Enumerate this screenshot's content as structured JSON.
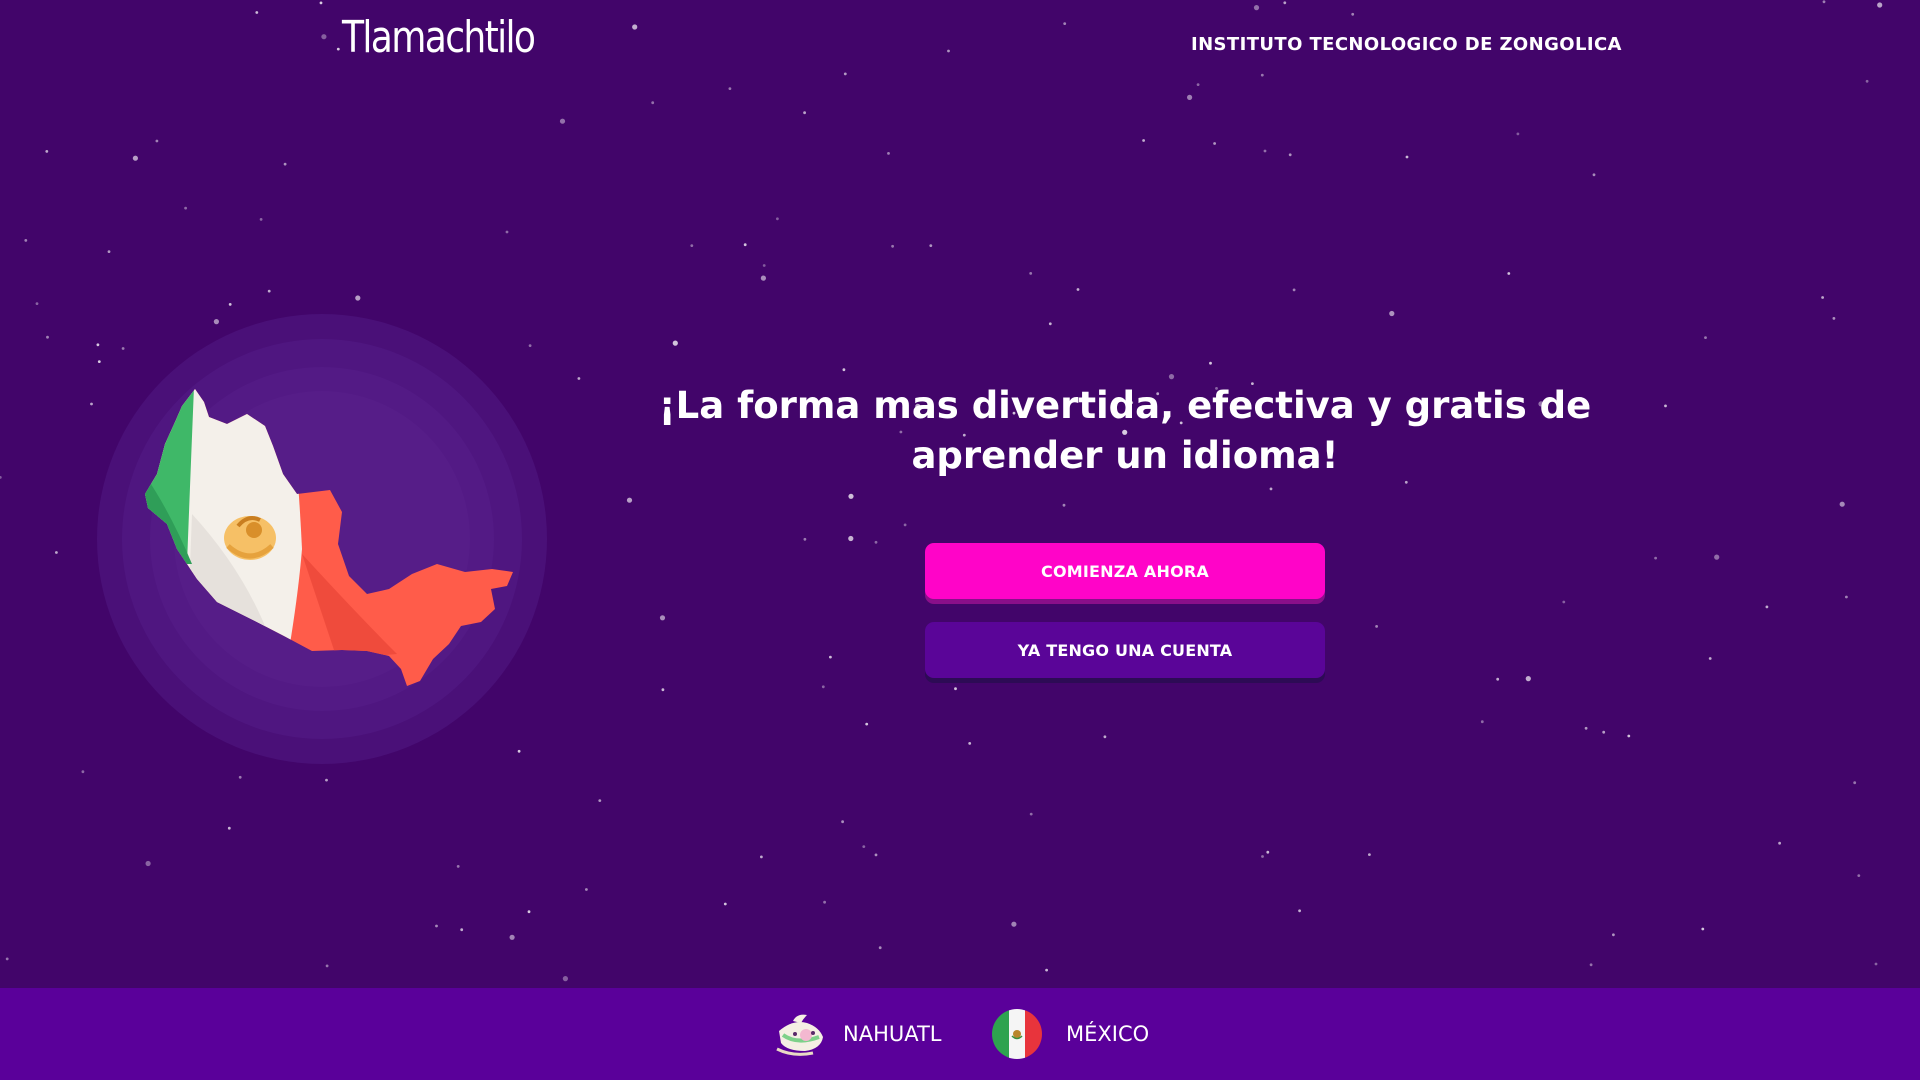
{
  "header": {
    "logo_text": "Tlamachtilo",
    "institute": "INSTITUTO TECNOLOGICO DE ZONGOLICA"
  },
  "hero": {
    "headline": "¡La forma mas divertida, efectiva y gratis de aprender un idioma!",
    "illustration_icon": "mexico-flag-map-icon"
  },
  "actions": {
    "start": "COMIENZA AHORA",
    "login": "YA TENGO UNA CUENTA"
  },
  "footer": {
    "language": {
      "label": "NAHUATL",
      "icon": "nahuatl-glyph-icon"
    },
    "country": {
      "label": "MÉXICO",
      "icon": "mexico-flag-icon"
    }
  },
  "colors": {
    "background": "#42056a",
    "footer": "#5a009a",
    "primary_button": "#ff04c8",
    "secondary_button": "#5a0598"
  }
}
